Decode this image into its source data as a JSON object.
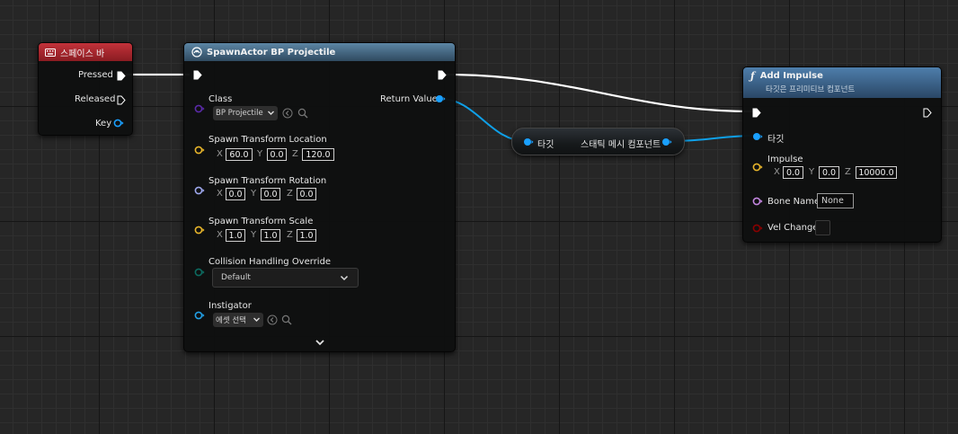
{
  "spacebar_node": {
    "title": "스페이스 바",
    "pins": {
      "pressed": "Pressed",
      "released": "Released",
      "key": "Key"
    }
  },
  "spawn_node": {
    "title": "SpawnActor BP Projectile",
    "class_label": "Class",
    "class_value": "BP Projectile",
    "return_label": "Return Value",
    "location": {
      "label": "Spawn Transform Location",
      "x": "60.0",
      "y": "0.0",
      "z": "120.0"
    },
    "rotation": {
      "label": "Spawn Transform Rotation",
      "x": "0.0",
      "y": "0.0",
      "z": "0.0"
    },
    "scale": {
      "label": "Spawn Transform Scale",
      "x": "1.0",
      "y": "1.0",
      "z": "1.0"
    },
    "collision": {
      "label": "Collision Handling Override",
      "value": "Default"
    },
    "instigator": {
      "label": "Instigator",
      "value": "에셋 선택"
    },
    "axis": {
      "x": "X",
      "y": "Y",
      "z": "Z"
    }
  },
  "cast_node": {
    "input_label": "타깃",
    "output_label": "스태틱 메시 컴포넌트"
  },
  "impulse_node": {
    "title": "Add Impulse",
    "subtitle": "타깃은 프리미티브 컴포넌트",
    "target_label": "타깃",
    "impulse": {
      "label": "Impulse",
      "x": "0.0",
      "y": "0.0",
      "z": "10000.0"
    },
    "bone_name": {
      "label": "Bone Name",
      "value": "None"
    },
    "vel_change": {
      "label": "Vel Change"
    },
    "axis": {
      "x": "X",
      "y": "Y",
      "z": "Z"
    }
  },
  "icons": {
    "keyboard": "keyboard-icon",
    "spawn": "spawn-actor-icon",
    "function": "function-icon",
    "exec_pin": "exec-pin-icon",
    "data_pin": "data-pin-icon",
    "browse": "browse-arrow-icon",
    "search": "search-icon",
    "chevron": "chevron-down-icon",
    "expand": "expand-chevron-icon"
  },
  "colors": {
    "spacebar_header": "#a8262b",
    "spawn_header": "#4a6f8a",
    "impulse_header": "#3f6b95",
    "object_pin": "#22a0e6",
    "vector_pin": "#e8b52a",
    "rotator_pin": "#9ea8ee",
    "class_pin": "#5a2aa8",
    "enum_pin": "#0c6b60",
    "name_pin": "#c486e0",
    "bool_pin": "#8a0000",
    "exec_wire": "#ffffff"
  }
}
